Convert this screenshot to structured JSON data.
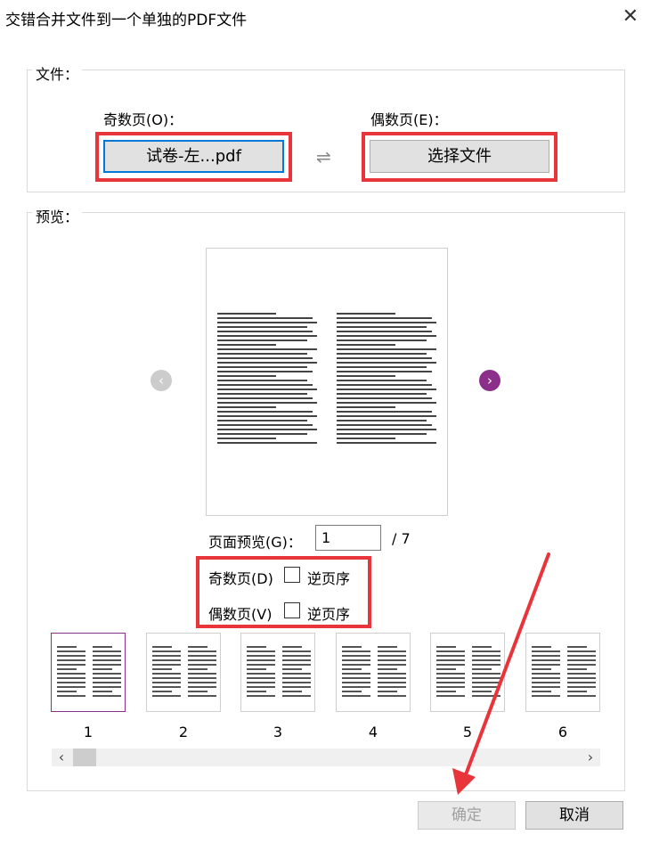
{
  "window": {
    "title": "交错合并文件到一个单独的PDF文件",
    "close_glyph": "✕"
  },
  "files_group": {
    "label": "文件：",
    "odd_label": "奇数页(O)：",
    "odd_file": "试卷-左...pdf",
    "swap_glyph": "⇌",
    "even_label": "偶数页(E)：",
    "even_button": "选择文件"
  },
  "preview_group": {
    "label": "预览：",
    "prev_glyph": "‹",
    "next_glyph": "›",
    "page_preview_label": "页面预览(G)：",
    "page_value": "1",
    "page_total": "/ 7",
    "odd_pages_label": "奇数页(D)",
    "even_pages_label": "偶数页(V)",
    "reverse_label": "逆页序",
    "odd_reverse_checked": false,
    "even_reverse_checked": false,
    "thumbnails": [
      "1",
      "2",
      "3",
      "4",
      "5",
      "6"
    ],
    "scroll_left_glyph": "‹",
    "scroll_right_glyph": "›"
  },
  "buttons": {
    "ok": "确定",
    "cancel": "取消"
  },
  "colors": {
    "highlight_red": "#e8343b",
    "accent_purple": "#8b2f8a",
    "focus_blue": "#0078d7"
  }
}
